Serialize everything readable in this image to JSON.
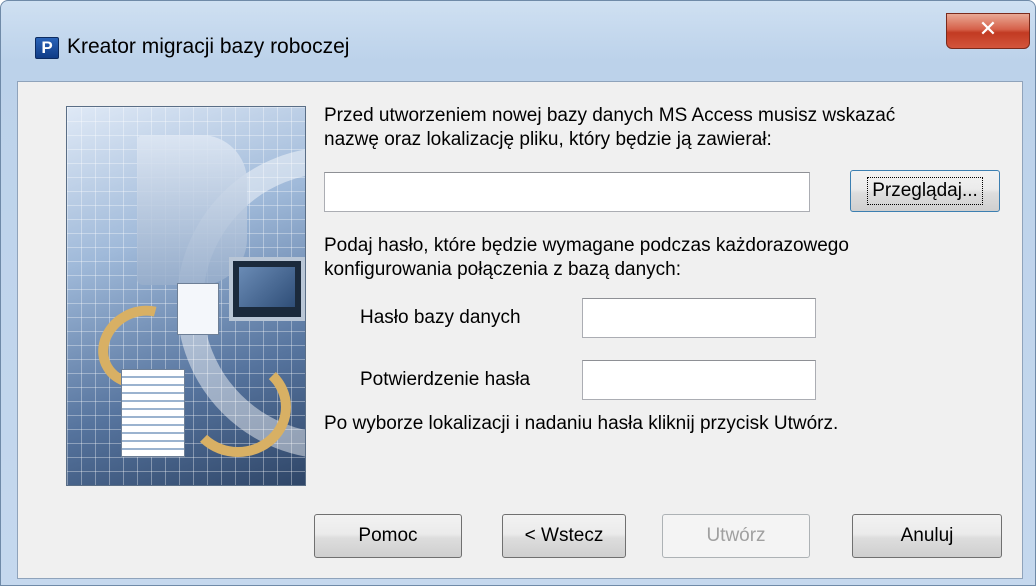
{
  "window": {
    "title": "Kreator migracji bazy roboczej",
    "app_icon_letter": "P",
    "close_glyph": "✕"
  },
  "intro_text_line1": "Przed utworzeniem nowej bazy danych MS Access musisz wskazać",
  "intro_text_line2": "nazwę oraz lokalizację pliku, który będzie ją zawierał:",
  "file_path": {
    "value": ""
  },
  "browse_button": {
    "label": "Przeglądaj..."
  },
  "password_intro_line1": "Podaj hasło, które będzie wymagane podczas każdorazowego",
  "password_intro_line2": "konfigurowania połączenia z bazą danych:",
  "password_label": "Hasło bazy danych",
  "password_value": "",
  "confirm_label": "Potwierdzenie hasła",
  "confirm_value": "",
  "footer_text": "Po wyborze lokalizacji i nadaniu hasła kliknij przycisk Utwórz.",
  "buttons": {
    "help": {
      "label": "Pomoc"
    },
    "back": {
      "label": "< Wstecz"
    },
    "create": {
      "label": "Utwórz",
      "enabled": false
    },
    "cancel": {
      "label": "Anuluj"
    }
  }
}
